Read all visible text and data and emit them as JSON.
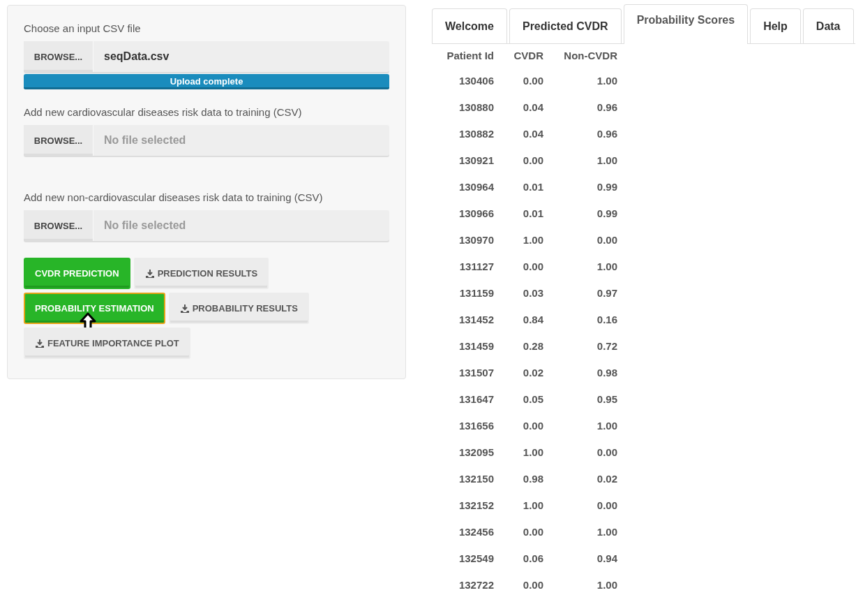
{
  "inputs": [
    {
      "label": "Choose an input CSV file",
      "button": "BROWSE...",
      "file": "seqData.csv",
      "file_selected": true,
      "progress": {
        "level": 1,
        "text": "Upload complete"
      }
    },
    {
      "label": "Add new cardiovascular diseases risk data to training (CSV)",
      "button": "BROWSE...",
      "file": "No file selected",
      "file_selected": false
    },
    {
      "label": "Add new non-cardiovascular diseases risk data to training (CSV)",
      "button": "BROWSE...",
      "file": "No file selected",
      "file_selected": false
    }
  ],
  "button_rows": [
    [
      {
        "label": "CVDR PREDICTION",
        "kind": "action",
        "focused": false
      },
      {
        "label": "PREDICTION RESULTS",
        "kind": "download",
        "focused": false
      }
    ],
    [
      {
        "label": "PROBABILITY ESTIMATION",
        "kind": "action",
        "focused": true
      },
      {
        "label": "PROBABILITY RESULTS",
        "kind": "download",
        "focused": false
      }
    ],
    [
      {
        "label": "FEATURE IMPORTANCE PLOT",
        "kind": "download",
        "focused": false
      }
    ]
  ],
  "tabs": [
    {
      "label": "Welcome",
      "selected": false
    },
    {
      "label": "Predicted CVDR",
      "selected": false
    },
    {
      "label": "Probability Scores",
      "selected": true
    },
    {
      "label": "Help",
      "selected": false
    },
    {
      "label": "Data",
      "selected": false
    }
  ],
  "table": {
    "columns": [
      "Patient Id",
      "CVDR",
      "Non-CVDR"
    ],
    "rows": [
      [
        "130406",
        "0.00",
        "1.00"
      ],
      [
        "130880",
        "0.04",
        "0.96"
      ],
      [
        "130882",
        "0.04",
        "0.96"
      ],
      [
        "130921",
        "0.00",
        "1.00"
      ],
      [
        "130964",
        "0.01",
        "0.99"
      ],
      [
        "130966",
        "0.01",
        "0.99"
      ],
      [
        "130970",
        "1.00",
        "0.00"
      ],
      [
        "131127",
        "0.00",
        "1.00"
      ],
      [
        "131159",
        "0.03",
        "0.97"
      ],
      [
        "131452",
        "0.84",
        "0.16"
      ],
      [
        "131459",
        "0.28",
        "0.72"
      ],
      [
        "131507",
        "0.02",
        "0.98"
      ],
      [
        "131647",
        "0.05",
        "0.95"
      ],
      [
        "131656",
        "0.00",
        "1.00"
      ],
      [
        "132095",
        "1.00",
        "0.00"
      ],
      [
        "132150",
        "0.98",
        "0.02"
      ],
      [
        "132152",
        "1.00",
        "0.00"
      ],
      [
        "132456",
        "0.00",
        "1.00"
      ],
      [
        "132549",
        "0.06",
        "0.94"
      ],
      [
        "132722",
        "0.00",
        "1.00"
      ]
    ]
  }
}
